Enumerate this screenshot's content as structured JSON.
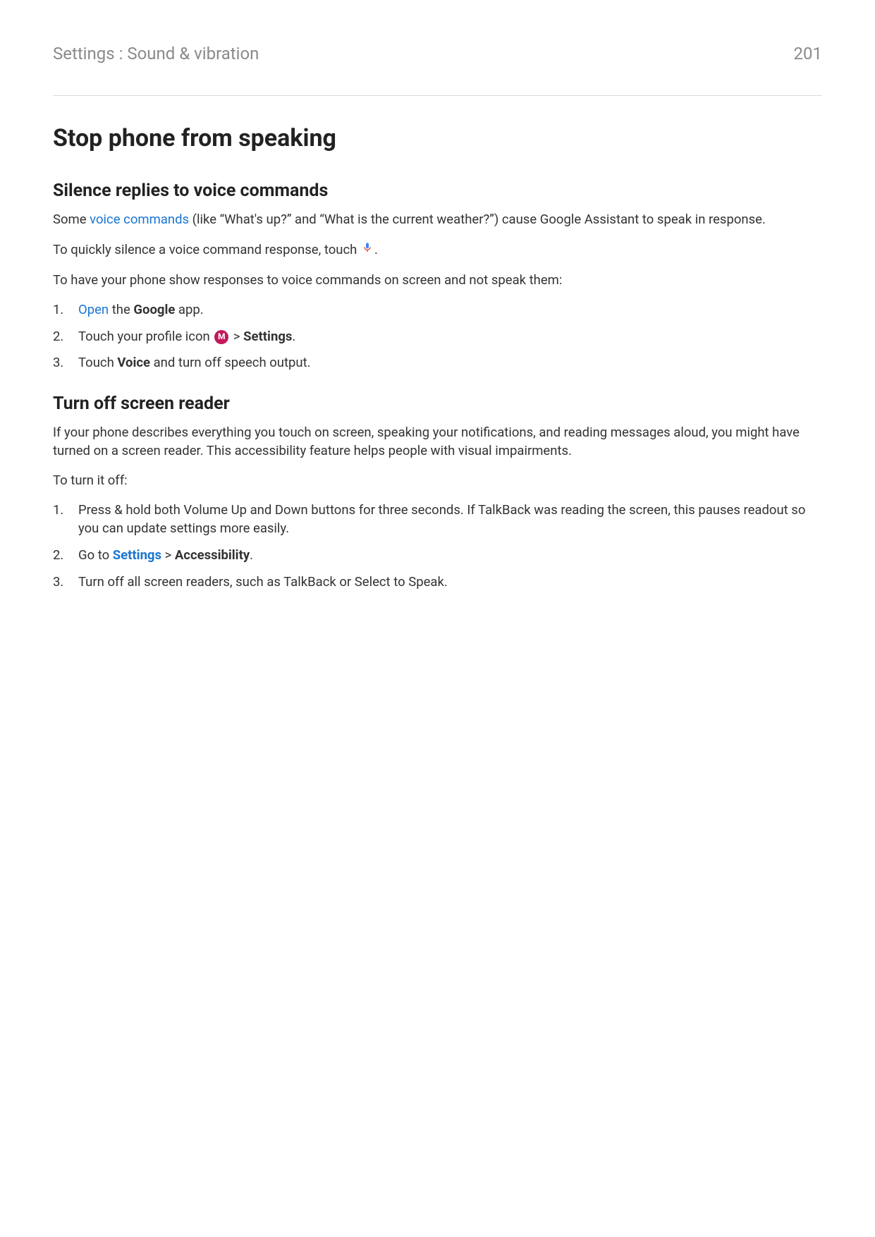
{
  "header": {
    "breadcrumb": "Settings : Sound & vibration",
    "pageNumber": "201"
  },
  "title": "Stop phone from speaking",
  "section1": {
    "heading": "Silence replies to voice commands",
    "p1_part1": "Some ",
    "p1_link": "voice commands",
    "p1_part2": " (like “What's up?” and “What is the current weather?”) cause Google Assistant to speak in response.",
    "p2_part1": "To quickly silence a voice command response, touch ",
    "p2_part2": ".",
    "p3": "To have your phone show responses to voice commands on screen and not speak them:",
    "steps": {
      "s1_link": "Open",
      "s1_part2": " the ",
      "s1_bold": "Google",
      "s1_part3": " app.",
      "s2_part1": "Touch your profile icon ",
      "s2_profile_letter": "M",
      "s2_part2": " > ",
      "s2_bold": "Settings",
      "s2_part3": ".",
      "s3_part1": "Touch ",
      "s3_bold": "Voice",
      "s3_part2": " and turn off speech output."
    }
  },
  "section2": {
    "heading": "Turn off screen reader",
    "p1": "If your phone describes everything you touch on screen, speaking your notifications, and reading messages aloud, you might have turned on a screen reader. This accessibility feature helps people with visual impairments.",
    "p2": "To turn it off:",
    "steps": {
      "s1": "Press & hold both Volume Up and Down buttons for three seconds. If TalkBack was reading the screen, this pauses readout so you can update settings more easily.",
      "s2_part1": "Go to ",
      "s2_link": "Settings",
      "s2_part2": " > ",
      "s2_bold": "Accessibility",
      "s2_part3": ".",
      "s3": "Turn off all screen readers, such as TalkBack or Select to Speak."
    }
  }
}
